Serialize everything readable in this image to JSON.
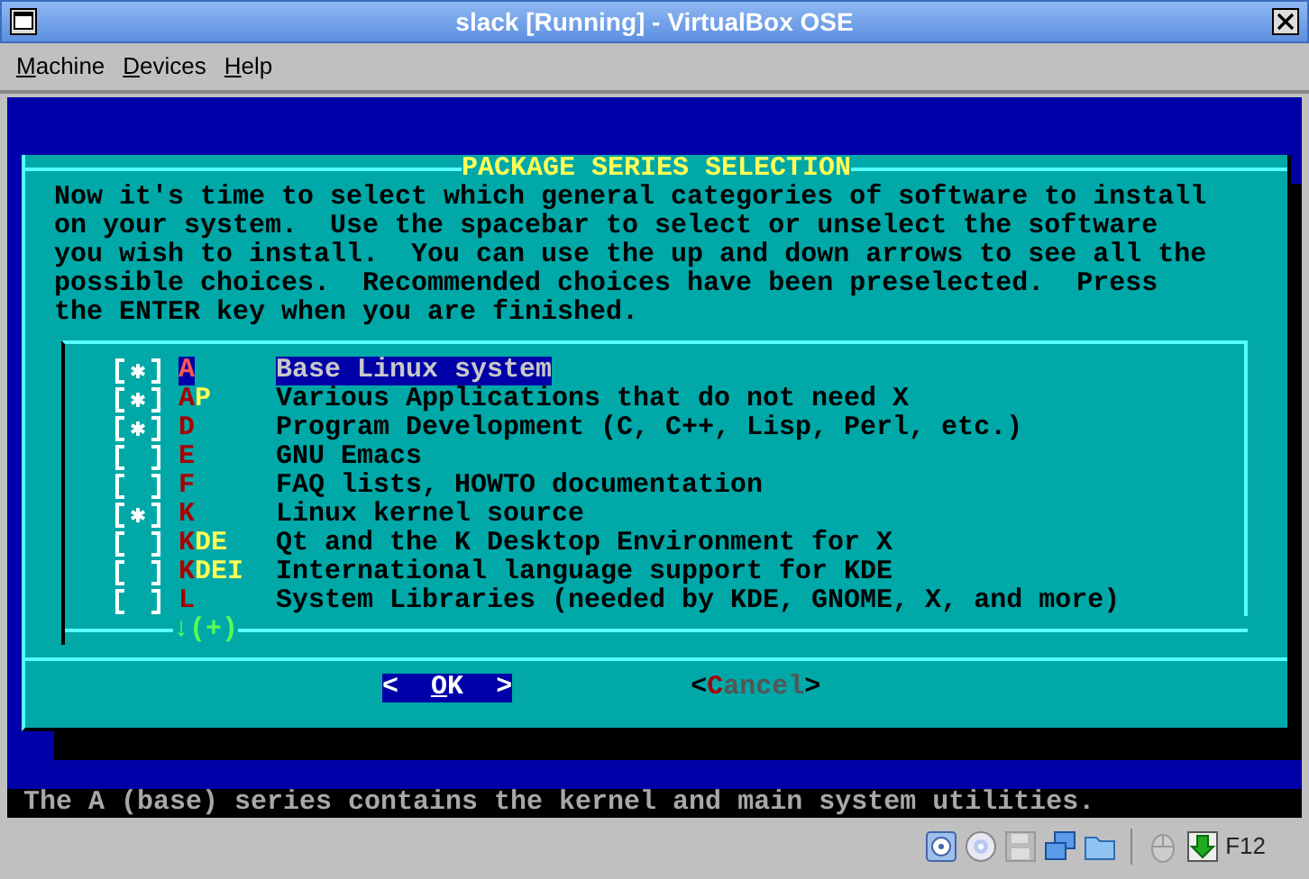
{
  "window": {
    "title": "slack [Running] - VirtualBox OSE"
  },
  "menu": [
    "Machine",
    "Devices",
    "Help"
  ],
  "dialog": {
    "title": "PACKAGE SERIES SELECTION",
    "intro": "Now it's time to select which general categories of software to install on your system.  Use the spacebar to select or unselect the software you wish to install.  You can use the up and down arrows to see all the possible choices.  Recommended choices have been preselected.  Press the ENTER key when you are finished.",
    "items": [
      {
        "checked": true,
        "tag": "A",
        "description": "Base Linux system",
        "selected": true
      },
      {
        "checked": true,
        "tag": "AP",
        "description": "Various Applications that do not need X",
        "selected": false
      },
      {
        "checked": true,
        "tag": "D",
        "description": "Program Development (C, C++, Lisp, Perl, etc.)",
        "selected": false
      },
      {
        "checked": false,
        "tag": "E",
        "description": "GNU Emacs",
        "selected": false
      },
      {
        "checked": false,
        "tag": "F",
        "description": "FAQ lists, HOWTO documentation",
        "selected": false
      },
      {
        "checked": true,
        "tag": "K",
        "description": "Linux kernel source",
        "selected": false
      },
      {
        "checked": false,
        "tag": "KDE",
        "description": "Qt and the K Desktop Environment for X",
        "selected": false
      },
      {
        "checked": false,
        "tag": "KDEI",
        "description": "International language support for KDE",
        "selected": false
      },
      {
        "checked": false,
        "tag": "L",
        "description": "System Libraries (needed by KDE, GNOME, X, and more)",
        "selected": false
      }
    ],
    "scroll_hint": "↓(+)",
    "buttons": [
      {
        "open": "<",
        "label": "OK",
        "close": ">",
        "selected": true
      },
      {
        "open": "<",
        "label": "Cancel",
        "close": ">",
        "selected": false
      }
    ]
  },
  "console_status": "The A (base) series contains the kernel and main system utilities.",
  "status_bar": {
    "host_key": "F12"
  }
}
